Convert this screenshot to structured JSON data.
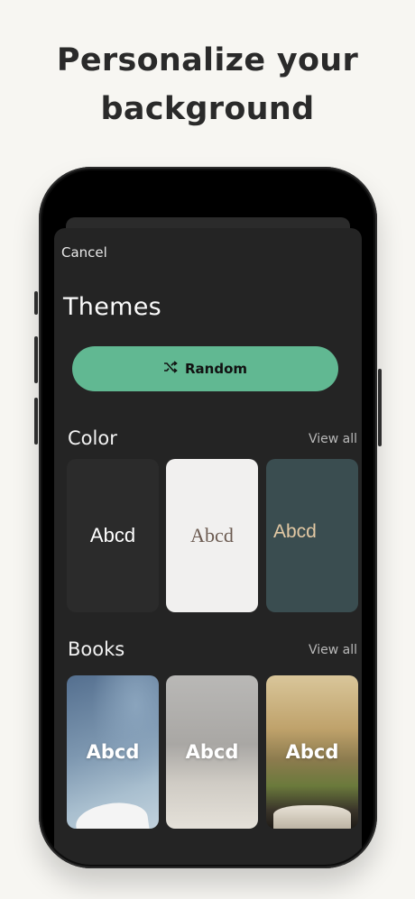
{
  "headline": {
    "line1": "Personalize your",
    "line2": "background"
  },
  "sheet": {
    "cancel_label": "Cancel",
    "title": "Themes",
    "random_label": "Random",
    "random_icon": "shuffle-icon",
    "accent_color": "#61b892"
  },
  "color_section": {
    "title": "Color",
    "view_all": "View all",
    "cards": [
      {
        "label": "Abcd",
        "bg": "#2b2b2b"
      },
      {
        "label": "Abcd",
        "bg": "#f1f0ef"
      },
      {
        "label": "Abcd",
        "bg": "#3a4d50"
      }
    ]
  },
  "books_section": {
    "title": "Books",
    "view_all": "View all",
    "cards": [
      {
        "label": "Abcd"
      },
      {
        "label": "Abcd"
      },
      {
        "label": "Abcd"
      }
    ]
  }
}
